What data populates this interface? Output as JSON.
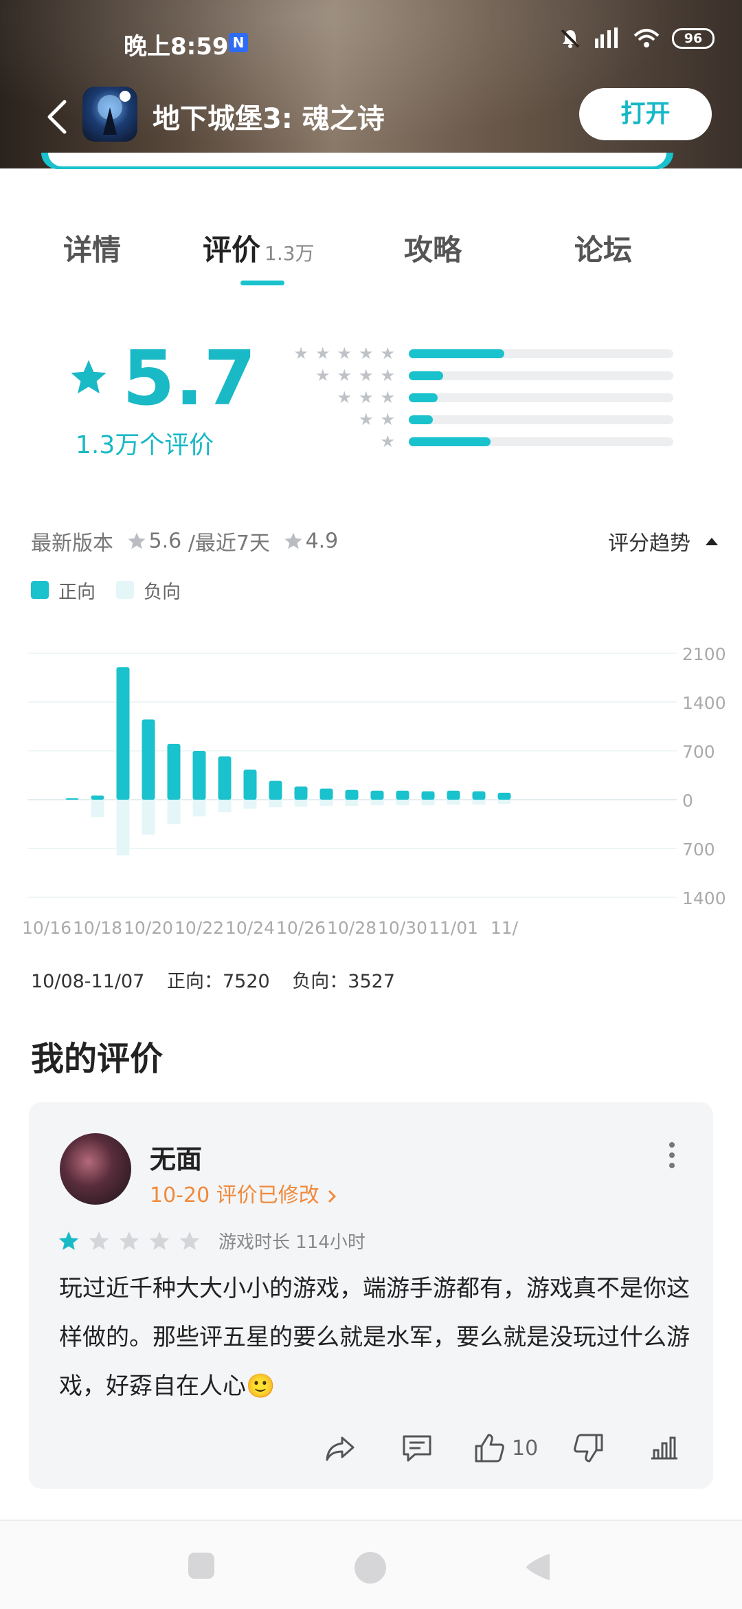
{
  "status_bar": {
    "time": "晚上8:59",
    "notif_badge": "N",
    "battery": "96"
  },
  "app": {
    "title": "地下城堡3: 魂之诗",
    "open_label": "打开"
  },
  "tabs": [
    {
      "label": "详情"
    },
    {
      "label": "评价",
      "count": "1.3万"
    },
    {
      "label": "攻略"
    },
    {
      "label": "论坛"
    }
  ],
  "rating": {
    "score": "5.7",
    "count_label": "1.3万个评价",
    "distribution": [
      {
        "stars": 5,
        "fraction": 0.36
      },
      {
        "stars": 4,
        "fraction": 0.13
      },
      {
        "stars": 3,
        "fraction": 0.11
      },
      {
        "stars": 2,
        "fraction": 0.09
      },
      {
        "stars": 1,
        "fraction": 0.31
      }
    ]
  },
  "version": {
    "latest_label": "最新版本",
    "latest_score": "5.6",
    "recent_label": "/最近7天",
    "recent_score": "4.9",
    "trend_label": "评分趋势"
  },
  "legend": {
    "positive": "正向",
    "negative": "负向"
  },
  "colors": {
    "accent": "#19c2cc",
    "negative": "#e4f6f8",
    "orange": "#f08a3c"
  },
  "chart_data": {
    "type": "bar",
    "x": [
      "10/17",
      "10/18",
      "10/19",
      "10/20",
      "10/21",
      "10/22",
      "10/23",
      "10/24",
      "10/25",
      "10/26",
      "10/27",
      "10/28",
      "10/29",
      "10/30",
      "10/31",
      "11/01",
      "11/02",
      "11/03"
    ],
    "x_tick_labels": [
      "10/16",
      "10/18",
      "10/20",
      "10/22",
      "10/24",
      "10/26",
      "10/28",
      "10/30",
      "11/01",
      "11/"
    ],
    "series": [
      {
        "name": "正向",
        "values": [
          10,
          60,
          1900,
          1150,
          800,
          700,
          620,
          430,
          270,
          190,
          160,
          140,
          130,
          130,
          120,
          130,
          120,
          100
        ]
      },
      {
        "name": "负向",
        "values": [
          0,
          250,
          800,
          500,
          350,
          240,
          180,
          130,
          110,
          100,
          90,
          90,
          80,
          80,
          80,
          70,
          70,
          60
        ]
      }
    ],
    "y_ticks_up": [
      "2100",
      "1400",
      "700",
      "0"
    ],
    "y_ticks_down": [
      "700",
      "1400"
    ],
    "ylim": [
      -1400,
      2100
    ]
  },
  "range": {
    "dates": "10/08-11/07",
    "positive": "正向：7520",
    "negative": "负向：3527"
  },
  "my_review": {
    "section_title": "我的评价",
    "username": "无面",
    "meta": "10-20 评价已修改",
    "stars": 1,
    "playtime": "游戏时长 114小时",
    "text": "玩过近千种大大小小的游戏，端游手游都有，游戏真不是你这样做的。那些评五星的要么就是水军，要么就是没玩过什么游戏，好孬自在人心🙂",
    "likes": "10"
  }
}
